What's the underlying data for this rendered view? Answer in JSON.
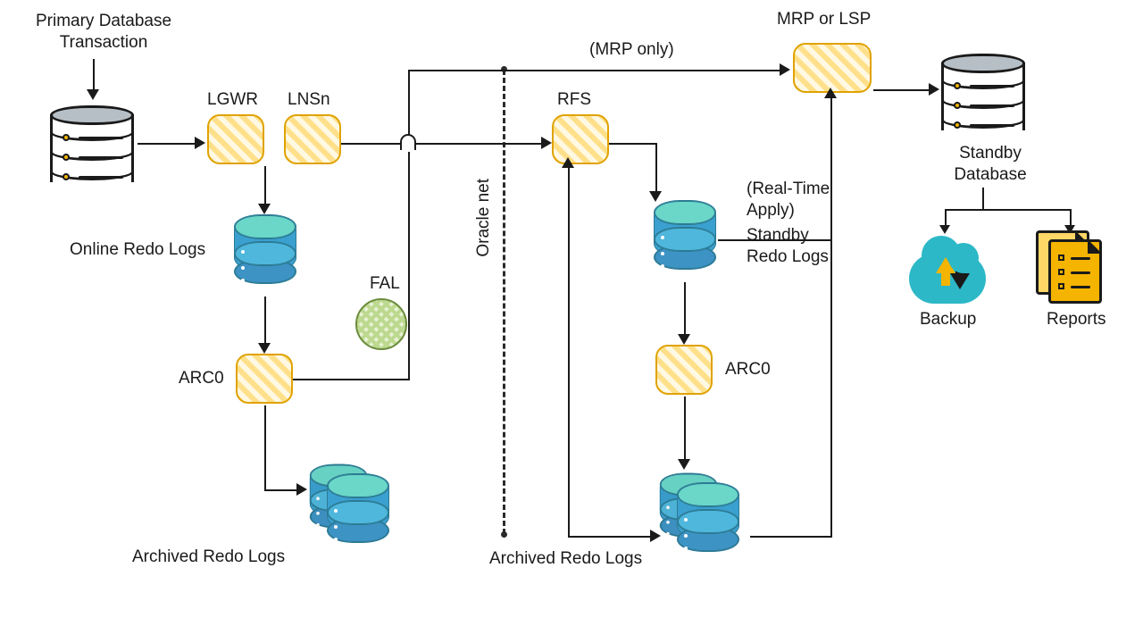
{
  "primary": {
    "title": "Primary Database\nTransaction",
    "lgwr": "LGWR",
    "lnsn": "LNSn",
    "online_redo": "Online Redo Logs",
    "arc0": "ARC0",
    "fal": "FAL",
    "archived_redo": "Archived Redo Logs"
  },
  "net": {
    "label": "Oracle net",
    "mrp_only": "(MRP only)"
  },
  "standby": {
    "rfs": "RFS",
    "realtime_apply": "(Real-Time\nApply)",
    "standby_redo": "Standby\nRedo Logs",
    "arc0": "ARC0",
    "archived_redo": "Archived Redo Logs",
    "mrp_or_lsp": "MRP or LSP",
    "title": "Standby\nDatabase",
    "backup": "Backup",
    "reports": "Reports"
  }
}
